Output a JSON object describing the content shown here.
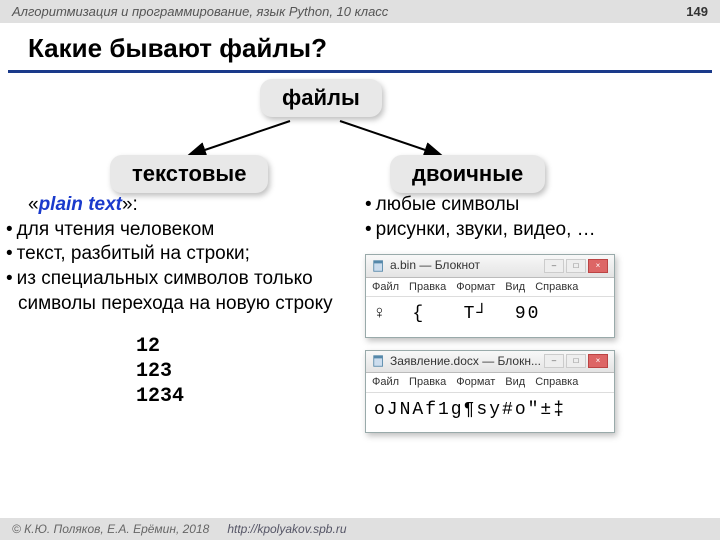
{
  "header": {
    "course": "Алгоритмизация и программирование, язык Python, 10 класс",
    "page": "149"
  },
  "title": "Какие бывают файлы?",
  "nodes": {
    "root": "файлы",
    "left": "текстовые",
    "right": "двоичные"
  },
  "text_col": {
    "lead_open": "«",
    "lead_term": "plain text",
    "lead_close": "»:",
    "items": [
      "для чтения человеком",
      "текст, разбитый на строки;",
      "из специальных символов только символы перехода на новую строку"
    ],
    "example": "12\n123\n1234"
  },
  "bin_col": {
    "items": [
      "любые символы",
      "рисунки, звуки, видео, …"
    ]
  },
  "notepad_menu": [
    "Файл",
    "Правка",
    "Формат",
    "Вид",
    "Справка"
  ],
  "np1": {
    "title": "a.bin — Блокнот",
    "content": "♀  {   T┘  90"
  },
  "np2": {
    "title": "Заявление.docx — Блокн...",
    "content": "oJNAf1g¶sy#o\"±‡"
  },
  "footer": {
    "copy": "© К.Ю. Поляков, Е.А. Ерёмин, 2018",
    "url": "http://kpolyakov.spb.ru"
  }
}
